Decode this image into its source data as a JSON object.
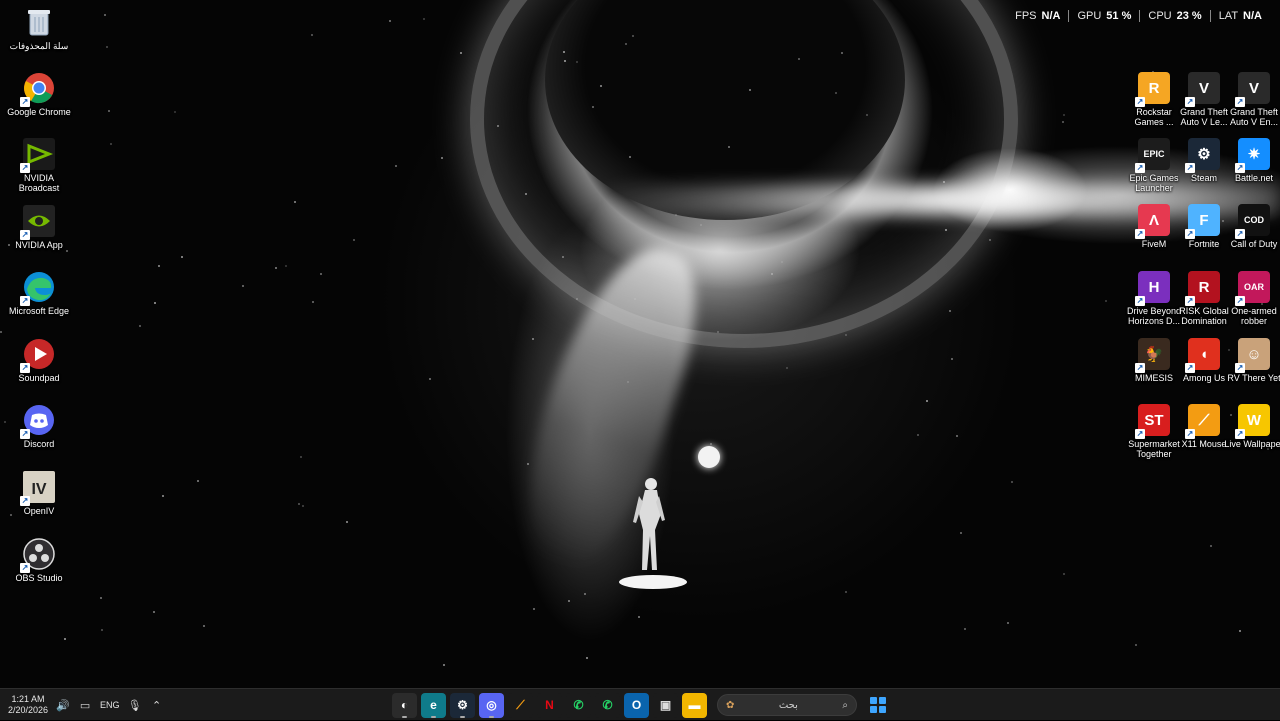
{
  "hud": {
    "metrics": [
      {
        "label": "FPS",
        "value": "N/A"
      },
      {
        "label": "GPU",
        "value": "51 %"
      },
      {
        "label": "CPU",
        "value": "23 %"
      },
      {
        "label": "LAT",
        "value": "N/A"
      }
    ]
  },
  "desktop": {
    "left_icons": [
      {
        "label": "سلة المحذوفات",
        "icon": "recycle-bin-icon"
      },
      {
        "label": "Google Chrome",
        "icon": "chrome-icon"
      },
      {
        "label": "NVIDIA Broadcast",
        "icon": "nvidia-broadcast-icon"
      },
      {
        "label": "NVIDIA App",
        "icon": "nvidia-app-icon"
      },
      {
        "label": "Microsoft Edge",
        "icon": "edge-icon"
      },
      {
        "label": "Soundpad",
        "icon": "soundpad-icon"
      },
      {
        "label": "Discord",
        "icon": "discord-icon"
      },
      {
        "label": "OpenIV",
        "icon": "openiv-icon"
      },
      {
        "label": "OBS Studio",
        "icon": "obs-icon"
      }
    ],
    "right_icons": [
      {
        "label": "Rockstar Games ...",
        "icon": "rockstar-icon",
        "color": "#f5a623",
        "glyph": "R"
      },
      {
        "label": "Grand Theft Auto V Le...",
        "icon": "gta-v-icon",
        "color": "#2a2a2a",
        "glyph": "V"
      },
      {
        "label": "Grand Theft Auto V En...",
        "icon": "gta-v-icon",
        "color": "#2a2a2a",
        "glyph": "V"
      },
      {
        "label": "Epic Games Launcher",
        "icon": "epic-games-icon",
        "color": "#1c1c1c",
        "glyph": "EPIC"
      },
      {
        "label": "Steam",
        "icon": "steam-icon",
        "color": "#1b2838",
        "glyph": "⚙"
      },
      {
        "label": "Battle.net",
        "icon": "battlenet-icon",
        "color": "#148eff",
        "glyph": "✷"
      },
      {
        "label": "FiveM",
        "icon": "fivem-icon",
        "color": "#e63950",
        "glyph": "Λ"
      },
      {
        "label": "Fortnite",
        "icon": "fortnite-icon",
        "color": "#4fb3ff",
        "glyph": "F"
      },
      {
        "label": "Call of Duty",
        "icon": "call-of-duty-icon",
        "color": "#111111",
        "glyph": "COD"
      },
      {
        "label": "Drive Beyond Horizons D...",
        "icon": "drive-beyond-horizons-icon",
        "color": "#7b2fbe",
        "glyph": "H"
      },
      {
        "label": "RISK Global Domination",
        "icon": "risk-icon",
        "color": "#b3121f",
        "glyph": "R"
      },
      {
        "label": "One-armed robber",
        "icon": "one-armed-robber-icon",
        "color": "#c2185b",
        "glyph": "OAR"
      },
      {
        "label": "MIMESIS",
        "icon": "mimesis-icon",
        "color": "#3a2a1f",
        "glyph": "🐓"
      },
      {
        "label": "Among Us",
        "icon": "among-us-icon",
        "color": "#e0301e",
        "glyph": "◖"
      },
      {
        "label": "RV There Yet",
        "icon": "rv-there-yet-icon",
        "color": "#c9a27a",
        "glyph": "☺"
      },
      {
        "label": "Supermarket Together",
        "icon": "supermarket-together-icon",
        "color": "#d81e1e",
        "glyph": "ST"
      },
      {
        "label": "X11 Mouse",
        "icon": "x11-mouse-icon",
        "color": "#f39c12",
        "glyph": "⟋"
      },
      {
        "label": "Live Wallpaper",
        "icon": "live-wallpaper-icon",
        "color": "#f7c600",
        "glyph": "W"
      }
    ]
  },
  "taskbar": {
    "time": "1:21 AM",
    "date": "2/20/2026",
    "language": "ENG",
    "search_placeholder": "بحث",
    "apps": [
      {
        "name": "snipping-tool",
        "color": "#2b2b2b",
        "glyph": "◐"
      },
      {
        "name": "edge",
        "color": "#0f7b8a",
        "glyph": "e"
      },
      {
        "name": "steam",
        "color": "#1b2838",
        "glyph": "⚙"
      },
      {
        "name": "discord",
        "color": "#5865f2",
        "glyph": "◎"
      },
      {
        "name": "x11-mouse",
        "color": "#1b1b1b",
        "glyph": "⟋"
      },
      {
        "name": "netflix",
        "color": "#1b1b1b",
        "glyph": "N"
      },
      {
        "name": "whatsapp",
        "color": "#1b1b1b",
        "glyph": "✆"
      },
      {
        "name": "whatsapp-beta",
        "color": "#1b1b1b",
        "glyph": "✆"
      },
      {
        "name": "outlook",
        "color": "#0a64ad",
        "glyph": "O"
      },
      {
        "name": "microsoft-store",
        "color": "#1b1b1b",
        "glyph": "▣"
      },
      {
        "name": "file-explorer",
        "color": "#f2b600",
        "glyph": "▬"
      }
    ]
  }
}
